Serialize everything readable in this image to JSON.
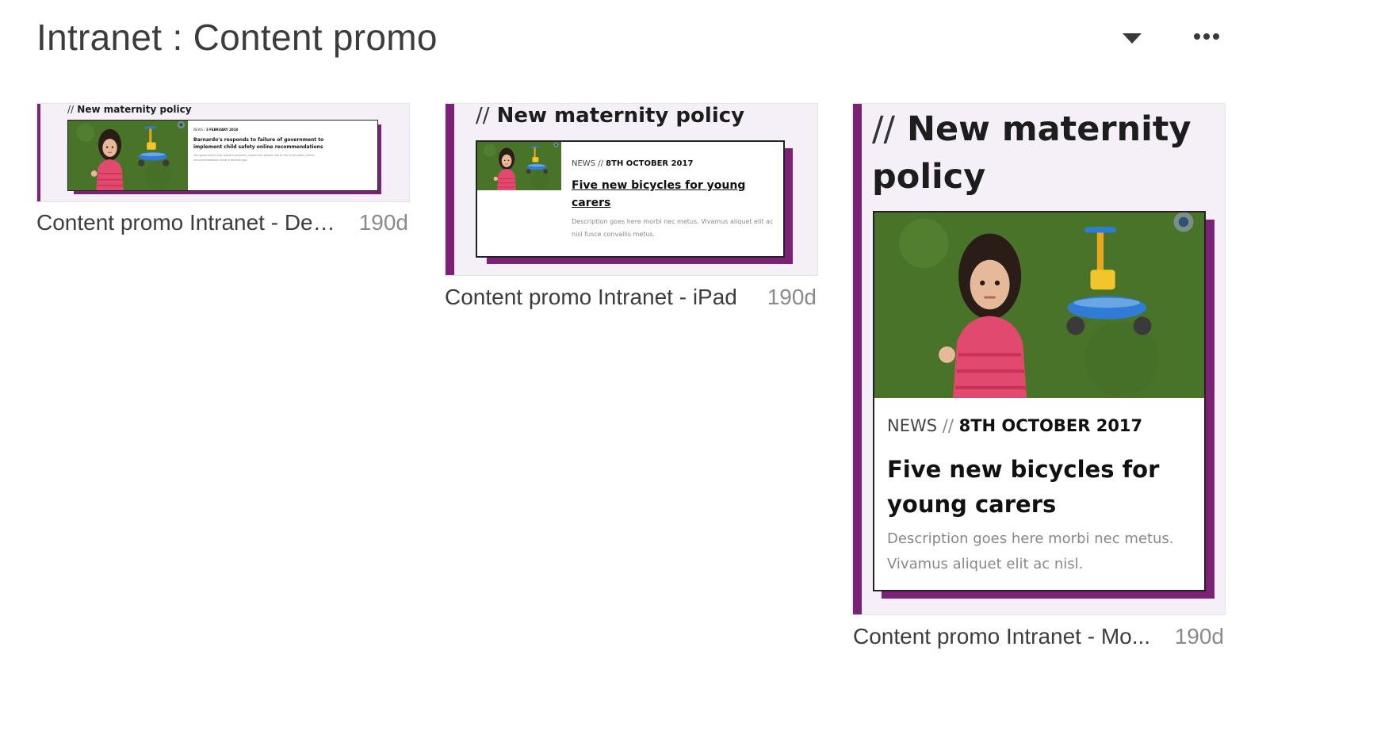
{
  "header": {
    "title": "Intranet : Content promo",
    "filter_icon": "caret-down-icon",
    "menu_icon": "more-horizontal-icon"
  },
  "colors": {
    "accent": "#7b2277",
    "thumb_bg": "#f5f0f7",
    "grass": "#4f7a2c"
  },
  "previews": [
    {
      "caption": "Content promo Intranet - Desktop",
      "age": "190d",
      "heading_prefix": "//",
      "heading": "New maternity policy",
      "meta_label": "NEWS",
      "meta_sep": "/",
      "meta_date": "3 FEBRUARY 2018",
      "headline": "Barnardo's responds to failure of government to implement child safety online recommendations",
      "description": "The government has failed to properly implement almost half of the child safety online recommendations made a decade ago."
    },
    {
      "caption": "Content promo Intranet - iPad",
      "age": "190d",
      "heading_prefix": "//",
      "heading": "New maternity policy",
      "meta_label": "NEWS",
      "meta_sep": "//",
      "meta_date": "8TH OCTOBER 2017",
      "headline": "Five new bicycles for young carers",
      "description": "Description goes here morbi nec metus. Vivamus aliquet elit ac nisl fusce convallis metus."
    },
    {
      "caption": "Content promo Intranet - Mo...",
      "age": "190d",
      "heading_prefix": "//",
      "heading": "New maternity policy",
      "meta_label": "NEWS",
      "meta_sep": "//",
      "meta_date": "8TH OCTOBER 2017",
      "headline": "Five new bicycles for young carers",
      "description": "Description goes here morbi nec metus. Vivamus aliquet elit ac nisl."
    }
  ]
}
